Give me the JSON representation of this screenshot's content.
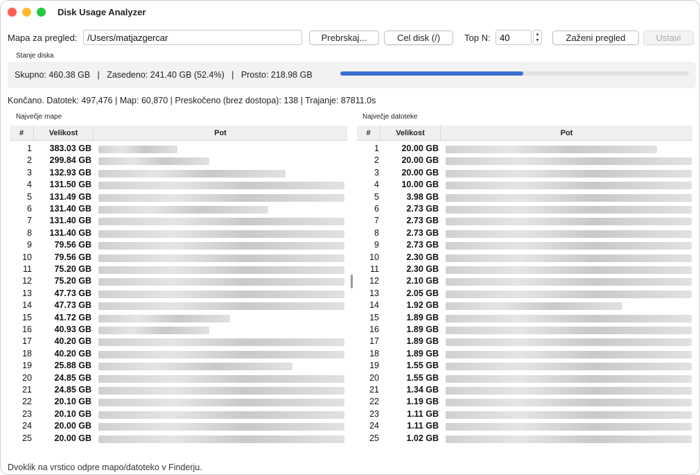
{
  "window": {
    "title": "Disk Usage Analyzer"
  },
  "toolbar": {
    "folder_label": "Mapa za pregled:",
    "folder_value": "/Users/matjazgercar",
    "browse_label": "Prebrskaj...",
    "whole_disk_label": "Cel disk (/)",
    "topn_label": "Top N:",
    "topn_value": "40",
    "run_label": "Zaženi pregled",
    "stop_label": "Ustavi"
  },
  "disk": {
    "group_label": "Stanje diska",
    "status_text": "Skupno: 460.38 GB   |   Zasedeno: 241.40 GB (52.4%)   |   Prosto: 218.98 GB",
    "used_fraction": 0.524,
    "accent_color": "#3b6fd0"
  },
  "summary": "Končano. Datotek: 497,476 | Map: 60,870 | Preskočeno (brez dostopa): 138 | Trajanje: 87811.0s",
  "folders": {
    "group_label": "Največje mape",
    "columns": [
      "#",
      "Velikost",
      "Pot"
    ],
    "rows": [
      {
        "n": "1",
        "size": "383.03 GB"
      },
      {
        "n": "2",
        "size": "299.84 GB"
      },
      {
        "n": "3",
        "size": "132.93 GB"
      },
      {
        "n": "4",
        "size": "131.50 GB"
      },
      {
        "n": "5",
        "size": "131.49 GB"
      },
      {
        "n": "6",
        "size": "131.40 GB"
      },
      {
        "n": "7",
        "size": "131.40 GB"
      },
      {
        "n": "8",
        "size": "131.40 GB"
      },
      {
        "n": "9",
        "size": "79.56 GB"
      },
      {
        "n": "10",
        "size": "79.56 GB"
      },
      {
        "n": "11",
        "size": "75.20 GB"
      },
      {
        "n": "12",
        "size": "75.20 GB"
      },
      {
        "n": "13",
        "size": "47.73 GB"
      },
      {
        "n": "14",
        "size": "47.73 GB"
      },
      {
        "n": "15",
        "size": "41.72 GB"
      },
      {
        "n": "16",
        "size": "40.93 GB"
      },
      {
        "n": "17",
        "size": "40.20 GB"
      },
      {
        "n": "18",
        "size": "40.20 GB"
      },
      {
        "n": "19",
        "size": "25.88 GB"
      },
      {
        "n": "20",
        "size": "24.85 GB"
      },
      {
        "n": "21",
        "size": "24.85 GB"
      },
      {
        "n": "22",
        "size": "20.10 GB"
      },
      {
        "n": "23",
        "size": "20.10 GB"
      },
      {
        "n": "24",
        "size": "20.00 GB"
      },
      {
        "n": "25",
        "size": "20.00 GB"
      }
    ]
  },
  "files": {
    "group_label": "Največje datoteke",
    "columns": [
      "#",
      "Velikost",
      "Pot"
    ],
    "rows": [
      {
        "n": "1",
        "size": "20.00 GB"
      },
      {
        "n": "2",
        "size": "20.00 GB"
      },
      {
        "n": "3",
        "size": "20.00 GB"
      },
      {
        "n": "4",
        "size": "10.00 GB"
      },
      {
        "n": "5",
        "size": "3.98 GB"
      },
      {
        "n": "6",
        "size": "2.73 GB"
      },
      {
        "n": "7",
        "size": "2.73 GB"
      },
      {
        "n": "8",
        "size": "2.73 GB"
      },
      {
        "n": "9",
        "size": "2.73 GB"
      },
      {
        "n": "10",
        "size": "2.30 GB"
      },
      {
        "n": "11",
        "size": "2.30 GB"
      },
      {
        "n": "12",
        "size": "2.10 GB"
      },
      {
        "n": "13",
        "size": "2.05 GB"
      },
      {
        "n": "14",
        "size": "1.92 GB"
      },
      {
        "n": "15",
        "size": "1.89 GB"
      },
      {
        "n": "16",
        "size": "1.89 GB"
      },
      {
        "n": "17",
        "size": "1.89 GB"
      },
      {
        "n": "18",
        "size": "1.89 GB"
      },
      {
        "n": "19",
        "size": "1.55 GB"
      },
      {
        "n": "20",
        "size": "1.55 GB"
      },
      {
        "n": "21",
        "size": "1.34 GB"
      },
      {
        "n": "22",
        "size": "1.19 GB"
      },
      {
        "n": "23",
        "size": "1.11 GB"
      },
      {
        "n": "24",
        "size": "1.11 GB"
      },
      {
        "n": "25",
        "size": "1.02 GB"
      }
    ]
  },
  "footer": "Dvoklik na vrstico odpre mapo/datoteko v Finderju."
}
